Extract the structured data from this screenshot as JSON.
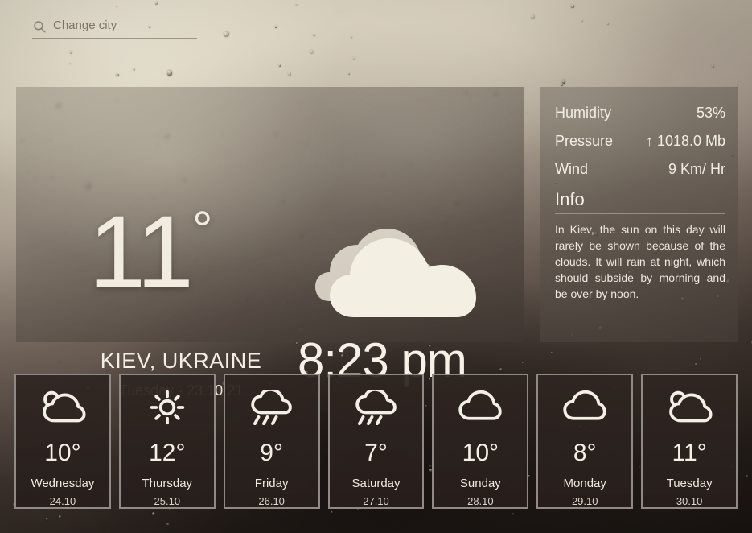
{
  "search": {
    "placeholder": "Change city",
    "value": "",
    "icon": "search-icon"
  },
  "current": {
    "temperature": "11",
    "degree_symbol": "°",
    "city": "KIEV, UKRAINE",
    "date": "Tuesday - 23.10.21",
    "time": "8:23 pm",
    "condition_icon": "overcast-clouds-icon"
  },
  "metrics": [
    {
      "label": "Humidity",
      "value": "53%"
    },
    {
      "label": "Pressure",
      "value": "↑ 1018.0 Mb"
    },
    {
      "label": "Wind",
      "value": "9 Km/ Hr"
    }
  ],
  "info": {
    "title": "Info",
    "text": "In Kiev, the sun on this day will rarely be shown because of the clouds. It will rain at night, which should subside by morning and be over by noon."
  },
  "forecast": [
    {
      "icon": "partly-cloudy-icon",
      "temp": "10°",
      "day": "Wednesday",
      "date": "24.10"
    },
    {
      "icon": "sun-icon",
      "temp": "12°",
      "day": "Thursday",
      "date": "25.10"
    },
    {
      "icon": "rain-cloud-icon",
      "temp": "9°",
      "day": "Friday",
      "date": "26.10"
    },
    {
      "icon": "rain-cloud-icon",
      "temp": "7°",
      "day": "Saturday",
      "date": "27.10"
    },
    {
      "icon": "cloud-icon",
      "temp": "10°",
      "day": "Sunday",
      "date": "28.10"
    },
    {
      "icon": "cloud-icon",
      "temp": "8°",
      "day": "Monday",
      "date": "29.10"
    },
    {
      "icon": "partly-cloudy-icon",
      "temp": "11°",
      "day": "Tuesday",
      "date": "30.10"
    }
  ],
  "colors": {
    "text_light": "#f4efe5",
    "card_border": "#8f8a85",
    "card_fill": "#2f2622",
    "panel_tint": "#6d6057"
  }
}
